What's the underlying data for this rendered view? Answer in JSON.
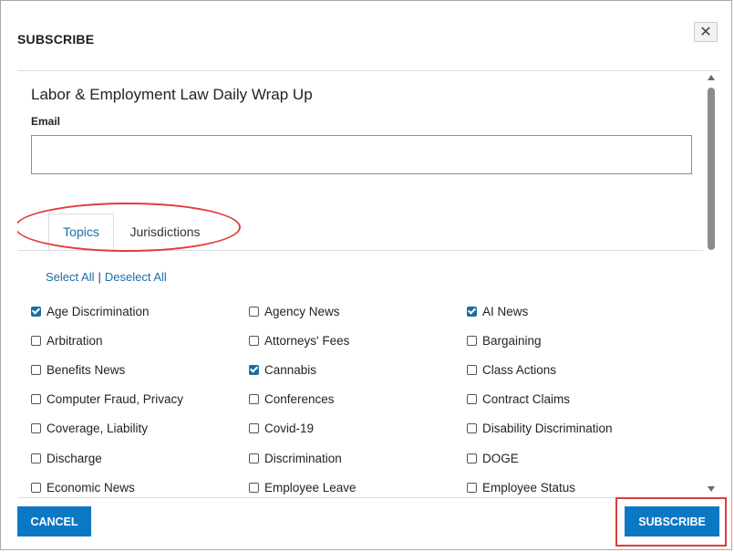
{
  "dialog": {
    "title": "SUBSCRIBE",
    "close_label": "✕"
  },
  "content": {
    "wrap_title": "Labor & Employment Law Daily Wrap Up",
    "email_label": "Email",
    "email_value": "",
    "tabs": [
      {
        "label": "Topics",
        "active": true
      },
      {
        "label": "Jurisdictions",
        "active": false
      }
    ],
    "select_all": "Select All",
    "separator": "|",
    "deselect_all": "Deselect All",
    "topics": [
      [
        {
          "label": "Age Discrimination",
          "checked": true
        },
        {
          "label": "Arbitration",
          "checked": false
        },
        {
          "label": "Benefits News",
          "checked": false
        },
        {
          "label": "Computer Fraud, Privacy",
          "checked": false
        },
        {
          "label": "Coverage, Liability",
          "checked": false
        },
        {
          "label": "Discharge",
          "checked": false
        },
        {
          "label": "Economic News",
          "checked": false
        }
      ],
      [
        {
          "label": "Agency News",
          "checked": false
        },
        {
          "label": "Attorneys' Fees",
          "checked": false
        },
        {
          "label": "Cannabis",
          "checked": true
        },
        {
          "label": "Conferences",
          "checked": false
        },
        {
          "label": "Covid-19",
          "checked": false
        },
        {
          "label": "Discrimination",
          "checked": false
        },
        {
          "label": "Employee Leave",
          "checked": false
        }
      ],
      [
        {
          "label": "AI News",
          "checked": true
        },
        {
          "label": "Bargaining",
          "checked": false
        },
        {
          "label": "Class Actions",
          "checked": false
        },
        {
          "label": "Contract Claims",
          "checked": false
        },
        {
          "label": "Disability Discrimination",
          "checked": false
        },
        {
          "label": "DOGE",
          "checked": false
        },
        {
          "label": "Employee Status",
          "checked": false
        }
      ]
    ]
  },
  "footer": {
    "cancel_label": "CANCEL",
    "subscribe_label": "SUBSCRIBE"
  },
  "colors": {
    "accent": "#0b78c4",
    "link": "#1a6ea3",
    "annotation": "#e03c3c"
  }
}
